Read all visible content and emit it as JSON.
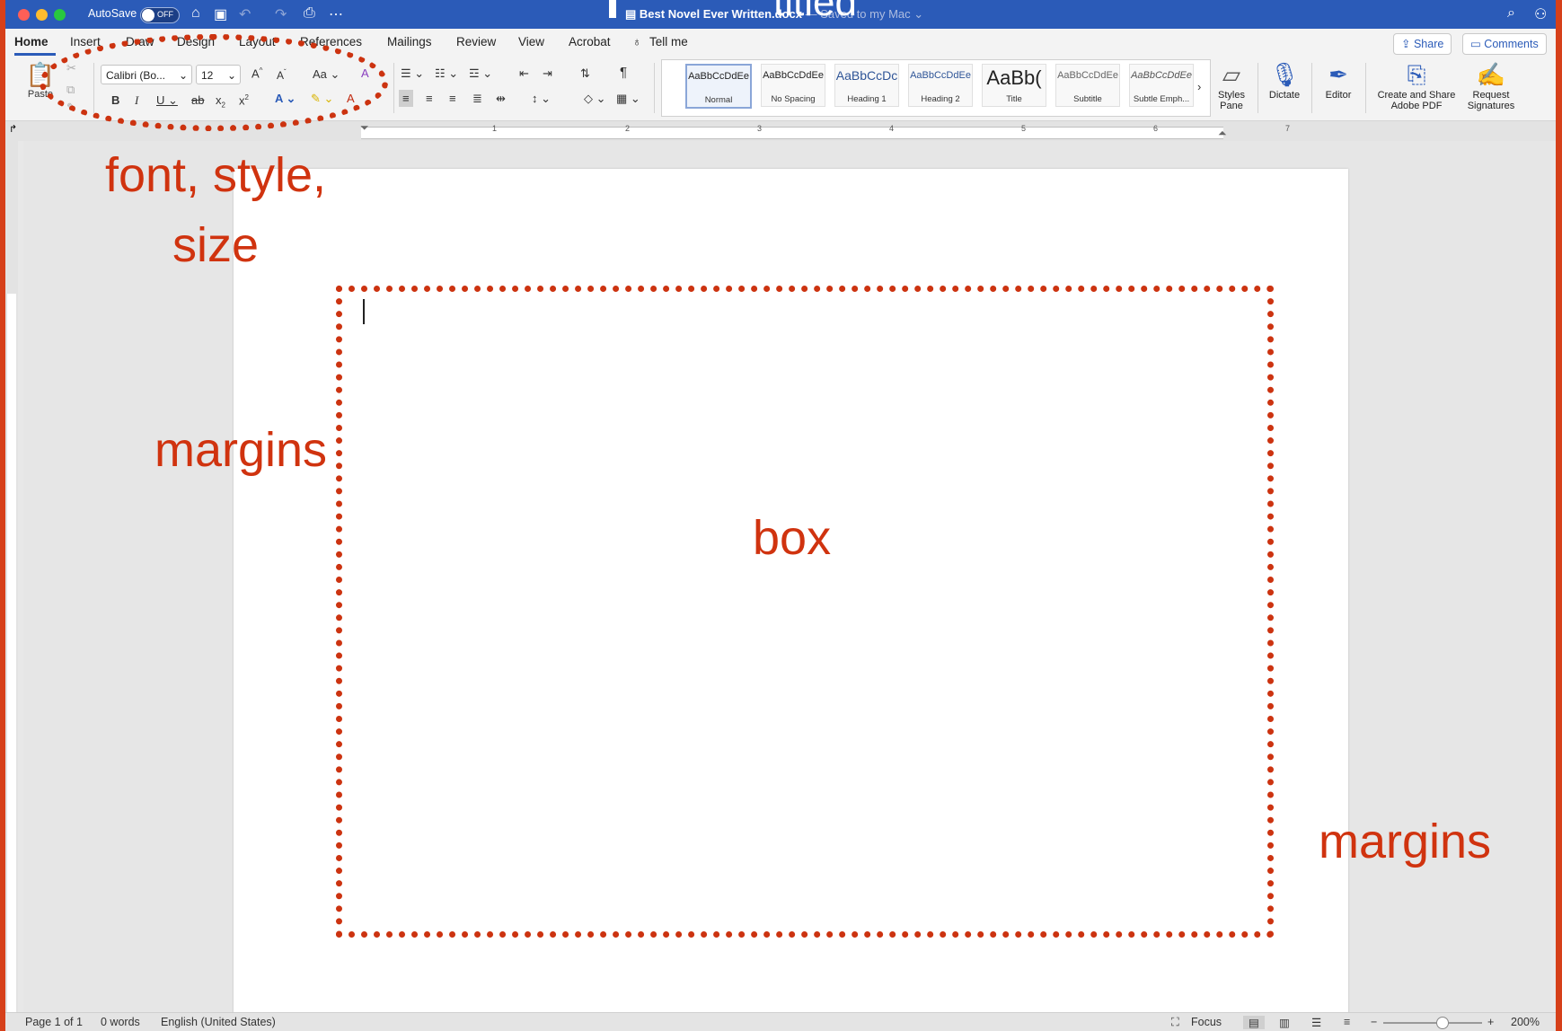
{
  "titlebar": {
    "autosave_label": "AutoSave",
    "autosave_state": "OFF",
    "doc_name": "Best Novel Ever Written.docx",
    "saved_status": " — Saved to my Mac ⌄"
  },
  "tabs": [
    "Home",
    "Insert",
    "Draw",
    "Design",
    "Layout",
    "References",
    "Mailings",
    "Review",
    "View",
    "Acrobat"
  ],
  "tell_me": "Tell me",
  "share_label": "Share",
  "comments_label": "Comments",
  "ribbon": {
    "paste_label": "Paste",
    "font_name": "Calibri (Bo...",
    "font_size": "12",
    "styles": [
      {
        "preview": "AaBbCcDdEe",
        "name": "Normal"
      },
      {
        "preview": "AaBbCcDdEe",
        "name": "No Spacing"
      },
      {
        "preview": "AaBbCcDc",
        "name": "Heading 1"
      },
      {
        "preview": "AaBbCcDdEe",
        "name": "Heading 2"
      },
      {
        "preview": "AaBb(",
        "name": "Title"
      },
      {
        "preview": "AaBbCcDdEe",
        "name": "Subtitle"
      },
      {
        "preview": "AaBbCcDdEe",
        "name": "Subtle Emph..."
      }
    ],
    "styles_pane": [
      "Styles",
      "Pane"
    ],
    "dictate": "Dictate",
    "editor": "Editor",
    "create_share": [
      "Create and Share",
      "Adobe PDF"
    ],
    "request_sig": [
      "Request",
      "Signatures"
    ]
  },
  "ruler_numbers": [
    "1",
    "2",
    "3",
    "4",
    "5",
    "6",
    "7"
  ],
  "annotations": {
    "titled": "titled",
    "font_style_size": [
      "font, style,",
      "size"
    ],
    "margins_left": "margins",
    "box": "box",
    "margins_right": "margins"
  },
  "status": {
    "page": "Page 1 of 1",
    "words": "0 words",
    "language": "English (United States)",
    "focus": "Focus",
    "zoom": "200%"
  }
}
